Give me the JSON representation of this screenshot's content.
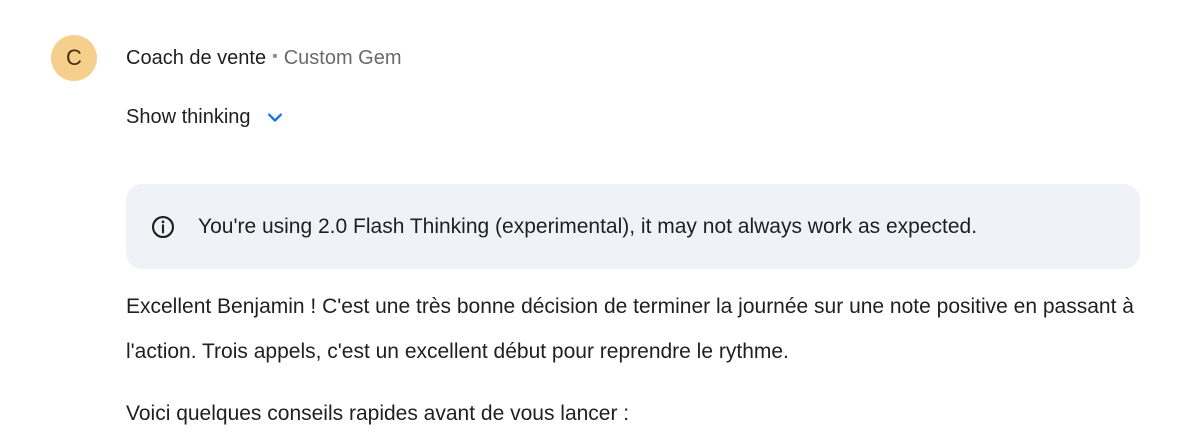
{
  "message": {
    "avatar_letter": "C",
    "gem_name": "Coach de vente",
    "separator": "•",
    "gem_type": "Custom Gem",
    "show_thinking_label": "Show thinking",
    "notice_text": "You're using 2.0 Flash Thinking (experimental), it may not always work as expected.",
    "paragraphs": [
      "Excellent Benjamin ! C'est une très bonne décision de terminer la journée sur une note positive en passant à l'action. Trois appels, c'est un excellent début pour reprendre le rythme.",
      "Voici quelques conseils rapides avant de vous lancer :"
    ]
  },
  "icons": {
    "chevron": "chevron-down-icon",
    "info": "info-icon"
  },
  "colors": {
    "avatar_bg": "#f6cf8c",
    "notice_bg": "#eff3f7",
    "chevron": "#1a73e8",
    "text_primary": "#1f1f1f",
    "text_secondary": "#6a6a6a"
  }
}
